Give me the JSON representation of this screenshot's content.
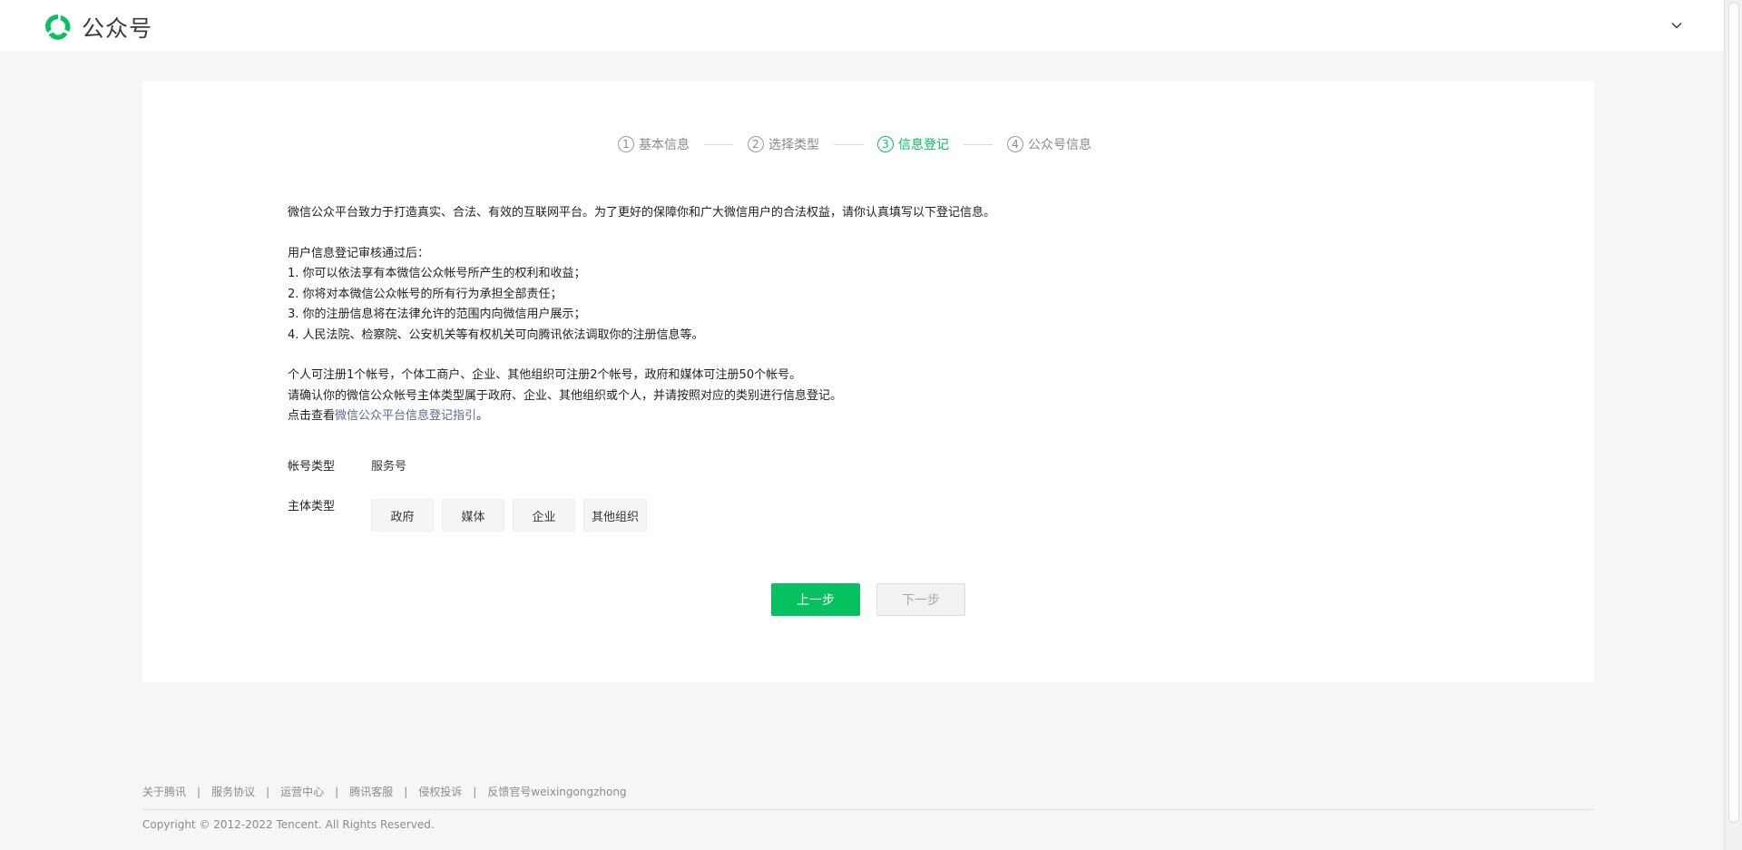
{
  "header": {
    "logo_text": "公众号",
    "dropdown_icon": "chevron-down-icon"
  },
  "colors": {
    "brand": "#07c160",
    "link": "#576b95",
    "active_step": "#07c160"
  },
  "steps": [
    {
      "num": "1",
      "label": "基本信息",
      "state": "done"
    },
    {
      "num": "2",
      "label": "选择类型",
      "state": "done"
    },
    {
      "num": "3",
      "label": "信息登记",
      "state": "active"
    },
    {
      "num": "4",
      "label": "公众号信息",
      "state": "todo"
    }
  ],
  "intro": {
    "line1": "微信公众平台致力于打造真实、合法、有效的互联网平台。为了更好的保障你和广大微信用户的合法权益，请你认真填写以下登记信息。",
    "list_title": "用户信息登记审核通过后：",
    "items": [
      "1. 你可以依法享有本微信公众帐号所产生的权利和收益；",
      "2. 你将对本微信公众帐号的所有行为承担全部责任；",
      "3. 你的注册信息将在法律允许的范围内向微信用户展示；",
      "4. 人民法院、检察院、公安机关等有权机关可向腾讯依法调取你的注册信息等。"
    ],
    "limits": "个人可注册1个帐号，个体工商户、企业、其他组织可注册2个帐号，政府和媒体可注册50个帐号。",
    "confirm": "请确认你的微信公众帐号主体类型属于政府、企业、其他组织或个人，并请按照对应的类别进行信息登记。",
    "guide_prefix": "点击查看",
    "guide_link": "微信公众平台信息登记指引",
    "guide_suffix": "。"
  },
  "form": {
    "account_type_label": "帐号类型",
    "account_type_value": "服务号",
    "subject_type_label": "主体类型",
    "subject_options": [
      "政府",
      "媒体",
      "企业",
      "其他组织"
    ]
  },
  "buttons": {
    "prev": "上一步",
    "next": "下一步"
  },
  "footer": {
    "links": [
      "关于腾讯",
      "服务协议",
      "运营中心",
      "腾讯客服",
      "侵权投诉",
      "反馈官号weixingongzhong"
    ],
    "separator": "|",
    "copyright": "Copyright © 2012-2022 Tencent. All Rights Reserved."
  }
}
